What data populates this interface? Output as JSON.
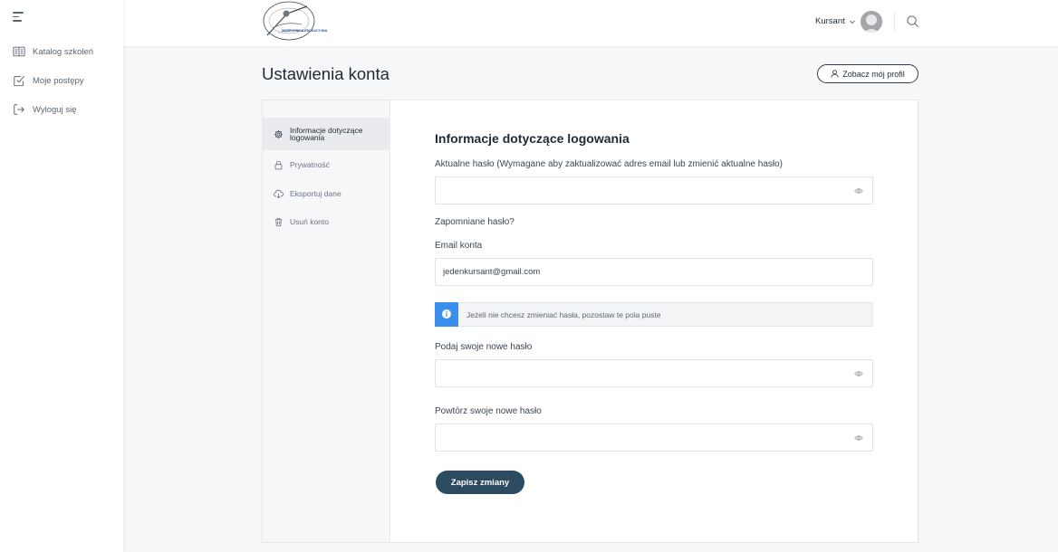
{
  "sidebar": {
    "items": [
      {
        "label": "Katalog szkoleń",
        "icon": "book-icon"
      },
      {
        "label": "Moje postępy",
        "icon": "checkbox-icon"
      },
      {
        "label": "Wyloguj się",
        "icon": "logout-icon"
      }
    ]
  },
  "header": {
    "logo_text": "WSZECHNICA EDUKACYJNA",
    "user_name": "Kursant"
  },
  "page": {
    "title": "Ustawienia konta",
    "profile_button": "Zobacz mój profil"
  },
  "settings_tabs": [
    {
      "line1": "Informacje dotyczące",
      "line2": "logowania",
      "icon": "gear-icon",
      "active": true
    },
    {
      "line1": "Prywatność",
      "line2": "",
      "icon": "lock-icon",
      "active": false
    },
    {
      "line1": "Eksportuj dane",
      "line2": "",
      "icon": "cloud-download-icon",
      "active": false
    },
    {
      "line1": "Usuń konto",
      "line2": "",
      "icon": "trash-icon",
      "active": false
    }
  ],
  "form": {
    "section_title": "Informacje dotyczące logowania",
    "current_password_label": "Aktualne hasło (Wymagane aby zaktualizować adres email lub zmienić aktualne hasło)",
    "current_password_value": "",
    "forgot_password_link": "Zapomniane hasło?",
    "email_label": "Email konta",
    "email_value": "jedenkursant@gmail.com",
    "notice_text": "Jeżeli nie chcesz zmieniać hasła, pozostaw te pola puste",
    "new_password_label": "Podaj swoje nowe hasło",
    "new_password_value": "",
    "repeat_password_label": "Powtórz swoje nowe hasło",
    "repeat_password_value": "",
    "save_button": "Zapisz zmiany"
  },
  "colors": {
    "accent": "#2c4a60",
    "info": "#3a8cef",
    "text": "#1e2a36"
  }
}
